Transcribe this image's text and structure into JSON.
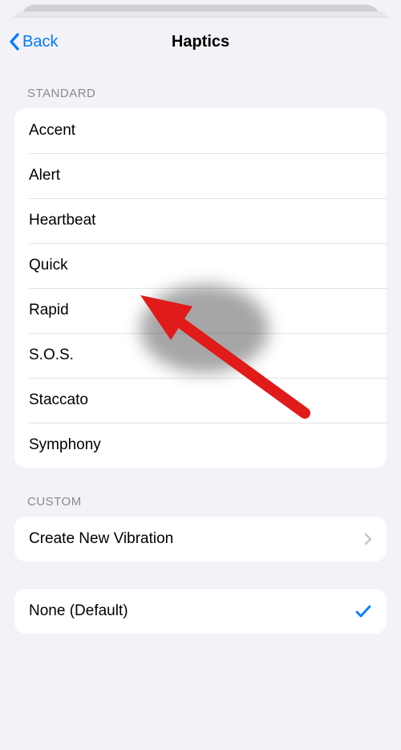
{
  "nav": {
    "back_label": "Back",
    "title": "Haptics"
  },
  "sections": {
    "standard": {
      "header": "Standard",
      "items": [
        {
          "label": "Accent"
        },
        {
          "label": "Alert"
        },
        {
          "label": "Heartbeat"
        },
        {
          "label": "Quick"
        },
        {
          "label": "Rapid"
        },
        {
          "label": "S.O.S."
        },
        {
          "label": "Staccato"
        },
        {
          "label": "Symphony"
        }
      ]
    },
    "custom": {
      "header": "Custom",
      "create_label": "Create New Vibration"
    },
    "none": {
      "label": "None (Default)",
      "selected": true
    }
  },
  "annotation": {
    "type": "arrow",
    "color": "#e11a1a",
    "target": "sections.standard.items.3"
  }
}
